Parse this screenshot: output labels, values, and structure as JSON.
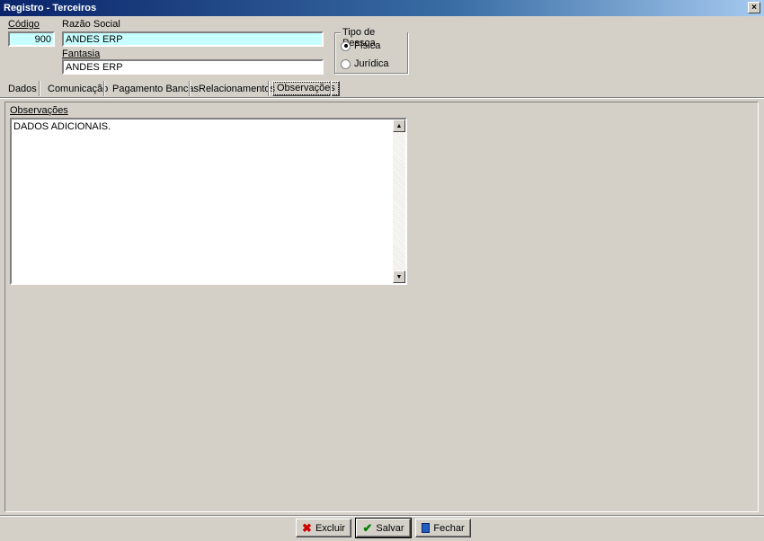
{
  "window": {
    "title": "Registro - Terceiros",
    "close_glyph": "×",
    "close_icon": "close-icon"
  },
  "header": {
    "codigo_label": "Código",
    "codigo_value": "900",
    "razao_label": "Razão Social",
    "razao_value": "ANDES ERP",
    "fantasia_label": "Fantasia",
    "fantasia_value": "ANDES ERP"
  },
  "tipo_pessoa": {
    "title": "Tipo de Pessoa",
    "options": [
      {
        "label": "Física",
        "selected": true
      },
      {
        "label": "Jurídica",
        "selected": false
      }
    ]
  },
  "tabs": [
    {
      "label": "Dados",
      "active": false
    },
    {
      "label": "Comunicação",
      "active": false
    },
    {
      "label": "Pagamento Bancas",
      "active": false
    },
    {
      "label": "Relacionamentos",
      "active": false
    },
    {
      "label": "Observações",
      "active": true
    }
  ],
  "observacoes": {
    "label": "Observações",
    "text": "DADOS ADICIONAIS."
  },
  "buttons": {
    "excluir": {
      "label": "Excluir",
      "icon": "x-icon",
      "color": "#cc0000"
    },
    "salvar": {
      "label": "Salvar",
      "icon": "check-icon",
      "color": "#008000"
    },
    "fechar": {
      "label": "Fechar",
      "icon": "door-icon",
      "color": "#1f5fbf"
    }
  },
  "colors": {
    "field_cyan": "#c8ffff",
    "face": "#d4d0c8",
    "title_start": "#0a246a"
  }
}
